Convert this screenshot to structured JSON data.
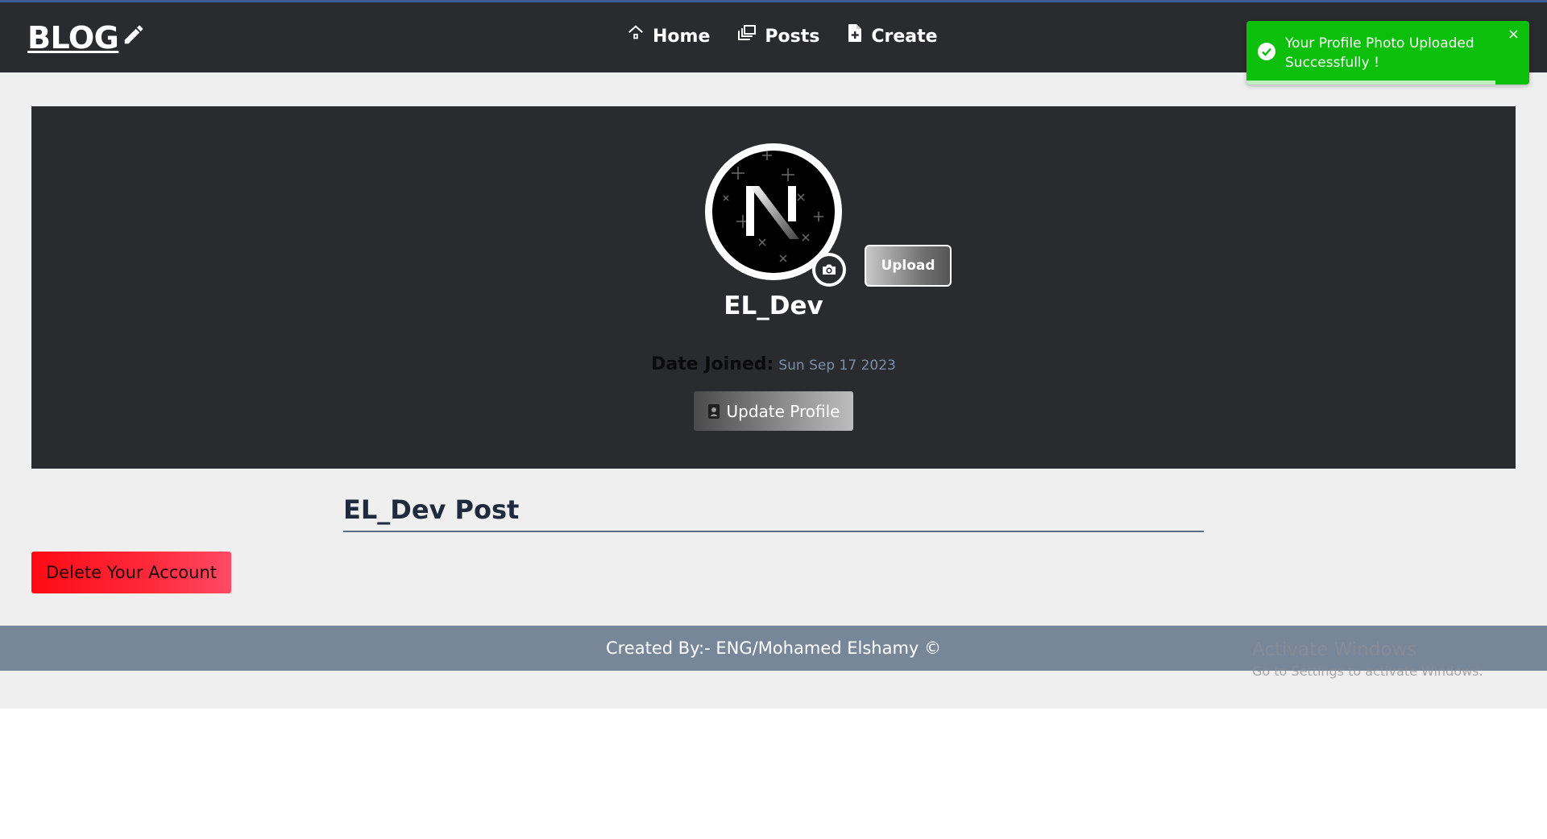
{
  "navbar": {
    "logo_text": "BLOG",
    "links": [
      {
        "label": "Home",
        "icon": "home-icon"
      },
      {
        "label": "Posts",
        "icon": "posts-icon"
      },
      {
        "label": "Create",
        "icon": "create-file-icon"
      }
    ]
  },
  "toast": {
    "message": "Your Profile Photo Uploaded Successfully !",
    "close_glyph": "×",
    "icon": "check-circle-icon",
    "progress": 0.88,
    "color": "#0bbf0b"
  },
  "profile": {
    "avatar_letter": "N",
    "upload_label": "Upload",
    "username": "EL_Dev",
    "date_joined_label": "Date Joined:",
    "date_joined_value": "Sun Sep 17 2023",
    "update_label": "Update Profile"
  },
  "posts": {
    "title": "EL_Dev Post"
  },
  "delete_label": "Delete Your Account",
  "footer": {
    "text": "Created By:- ENG/Mohamed Elshamy ©"
  },
  "watermark": {
    "title": "Activate Windows",
    "subtitle": "Go to Settings to activate Windows."
  },
  "colors": {
    "navbar_bg": "#2a2b2e",
    "page_bg": "#efefef",
    "delete_red": "#ff0a14",
    "footer_bg": "#778799"
  }
}
